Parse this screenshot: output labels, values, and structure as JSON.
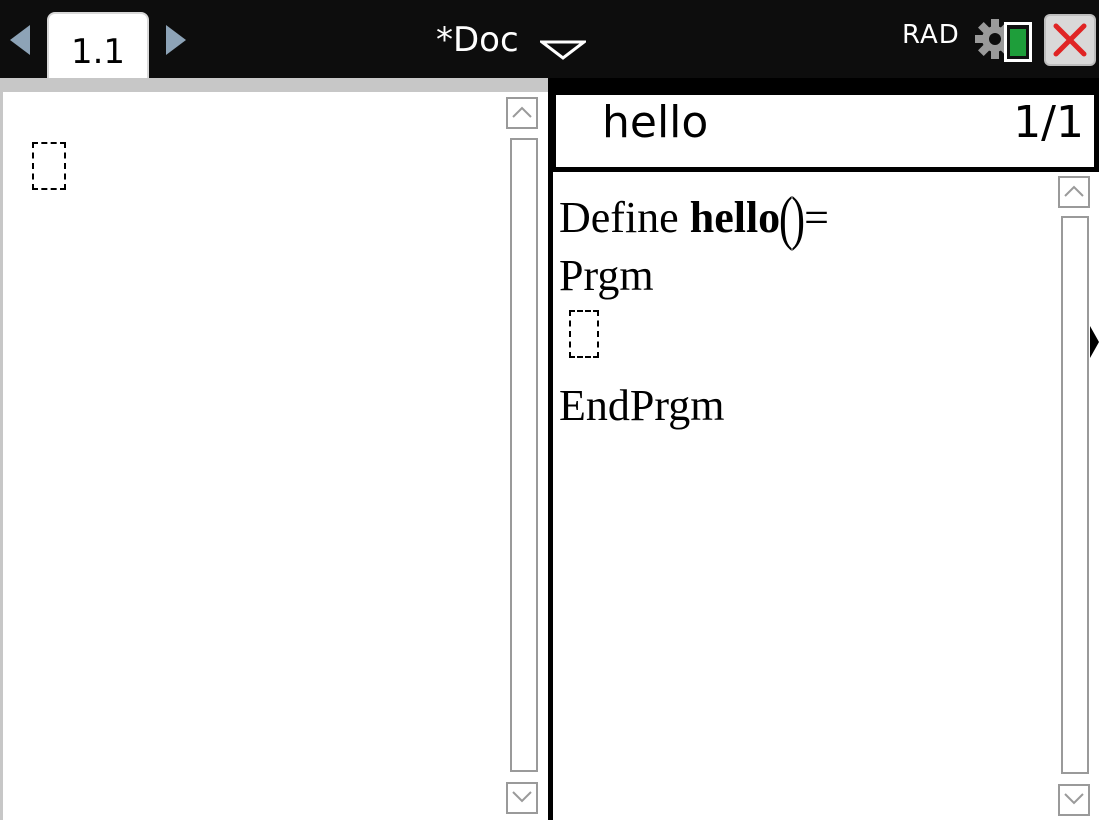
{
  "app": {
    "tab_label": "1.1",
    "document_title": "*Doc",
    "angle_mode": "RAD"
  },
  "icons": {
    "prev_page": "arrow-left-icon",
    "next_page": "arrow-right-icon",
    "doc_menu": "chevron-down-icon",
    "settings": "gear-icon",
    "battery": "battery-icon",
    "close": "close-icon"
  },
  "colors": {
    "topbar_bg": "#0d0d0d",
    "nav_arrow": "#8da3b7",
    "battery_level": "#1e9e3a",
    "close_x": "#e02424"
  },
  "program_editor": {
    "program_name": "hello",
    "page_indicator": "1/1",
    "code": {
      "define_keyword": "Define",
      "function_name": "hello",
      "paren_open": "(",
      "paren_close": ")",
      "equals": "=",
      "line_prgm": "Prgm",
      "line_endprgm": "EndPrgm"
    }
  },
  "battery_level": 0.8
}
